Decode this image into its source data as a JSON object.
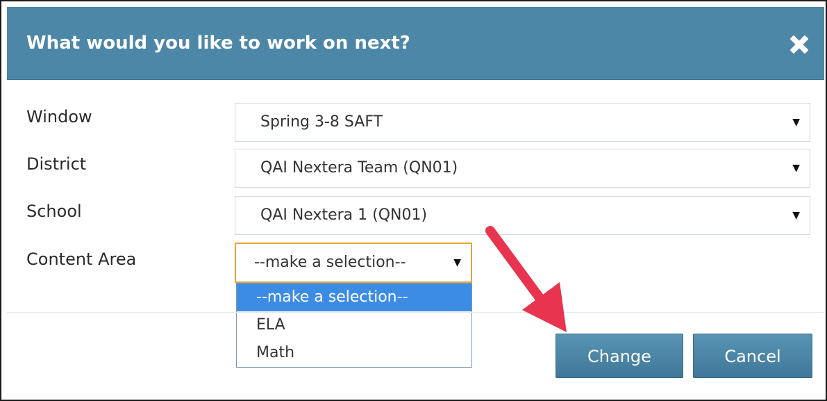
{
  "dialog": {
    "title": "What would you like to work on next?",
    "close_icon": "close-x-icon"
  },
  "fields": [
    {
      "label": "Window",
      "value": "Spring 3-8 SAFT"
    },
    {
      "label": "District",
      "value": "QAI Nextera Team (QN01)"
    },
    {
      "label": "School",
      "value": "QAI Nextera 1 (QN01)"
    }
  ],
  "content_area": {
    "label": "Content Area",
    "value": "--make a selection--",
    "options": [
      "--make a selection--",
      "ELA",
      "Math"
    ],
    "highlighted_index": 0
  },
  "buttons": {
    "change": "Change",
    "cancel": "Cancel"
  },
  "colors": {
    "header": "#4c87a7",
    "focus_border": "#e5a535",
    "highlight": "#3c8ce6",
    "annotation_arrow": "#e8344e"
  }
}
